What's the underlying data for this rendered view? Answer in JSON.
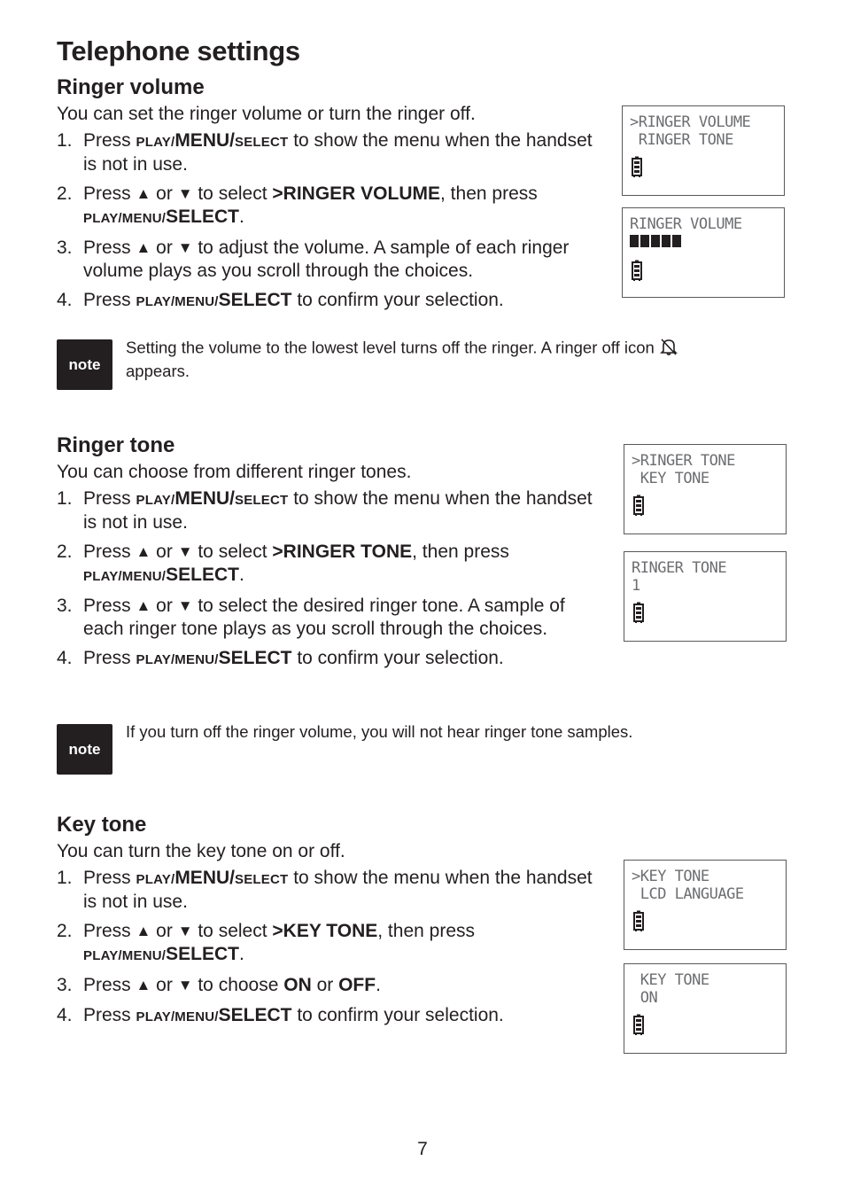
{
  "page": {
    "title": "Telephone settings",
    "page_number": "7"
  },
  "sections": [
    {
      "heading": "Ringer volume",
      "intro": "You can set the ringer volume or turn the ringer off.",
      "steps": [
        {
          "num": "1.",
          "segments": [
            {
              "t": "Press "
            },
            {
              "t": "PLAY/",
              "s": "sc"
            },
            {
              "t": "MENU/",
              "s": "lc"
            },
            {
              "t": "SELECT",
              "s": "sc"
            },
            {
              "t": " to show the menu when the handset is not in use."
            }
          ]
        },
        {
          "num": "2.",
          "segments": [
            {
              "t": "Press "
            },
            {
              "t": "▲",
              "s": "arrow"
            },
            {
              "t": " or "
            },
            {
              "t": "▼",
              "s": "arrow"
            },
            {
              "t": " to select "
            },
            {
              "t": ">RINGER VOLUME",
              "s": "b"
            },
            {
              "t": ", then press "
            },
            {
              "t": "PLAY/MENU/",
              "s": "sc"
            },
            {
              "t": "SELECT",
              "s": "lc"
            },
            {
              "t": "."
            }
          ]
        },
        {
          "num": "3.",
          "segments": [
            {
              "t": "Press "
            },
            {
              "t": "▲",
              "s": "arrow"
            },
            {
              "t": " or "
            },
            {
              "t": "▼",
              "s": "arrow"
            },
            {
              "t": " to adjust the volume. A sample of each ringer volume plays as you scroll through the choices."
            }
          ]
        },
        {
          "num": "4.",
          "segments": [
            {
              "t": "Press "
            },
            {
              "t": "PLAY/MENU/",
              "s": "sc"
            },
            {
              "t": "SELECT",
              "s": "lc"
            },
            {
              "t": " to confirm your selection."
            }
          ]
        }
      ],
      "screens": [
        {
          "lines": [
            ">RINGER VOLUME",
            " RINGER TONE"
          ],
          "battery": "battery-icon"
        },
        {
          "lines": [
            "RINGER VOLUME"
          ],
          "volume_level": 5,
          "volume_max": 5,
          "battery": "battery-icon"
        }
      ],
      "note": {
        "label": "note",
        "text_before_icon": "Setting the volume to the lowest level turns off the ringer. A ringer off icon",
        "icon": "ringer-off-icon",
        "text_after_icon": "appears."
      }
    },
    {
      "heading": "Ringer tone",
      "intro": "You can choose from different ringer tones.",
      "steps": [
        {
          "num": "1.",
          "segments": [
            {
              "t": "Press "
            },
            {
              "t": "PLAY/",
              "s": "sc"
            },
            {
              "t": "MENU/",
              "s": "lc"
            },
            {
              "t": "SELECT",
              "s": "sc"
            },
            {
              "t": " to show the menu when the handset is not in use."
            }
          ]
        },
        {
          "num": "2.",
          "segments": [
            {
              "t": "Press "
            },
            {
              "t": "▲",
              "s": "arrow"
            },
            {
              "t": " or "
            },
            {
              "t": "▼",
              "s": "arrow"
            },
            {
              "t": " to select "
            },
            {
              "t": ">RINGER TONE",
              "s": "b"
            },
            {
              "t": ", then press "
            },
            {
              "t": "PLAY/MENU/",
              "s": "sc"
            },
            {
              "t": "SELECT",
              "s": "lc"
            },
            {
              "t": "."
            }
          ]
        },
        {
          "num": "3.",
          "segments": [
            {
              "t": "Press "
            },
            {
              "t": "▲",
              "s": "arrow"
            },
            {
              "t": " or "
            },
            {
              "t": "▼",
              "s": "arrow"
            },
            {
              "t": " to select the desired ringer tone. A sample of each ringer tone plays as you scroll through the choices."
            }
          ]
        },
        {
          "num": "4.",
          "segments": [
            {
              "t": "Press "
            },
            {
              "t": "PLAY/MENU/",
              "s": "sc"
            },
            {
              "t": "SELECT",
              "s": "lc"
            },
            {
              "t": " to confirm your selection."
            }
          ]
        }
      ],
      "screens": [
        {
          "lines": [
            ">RINGER TONE",
            " KEY TONE"
          ],
          "battery": "battery-icon"
        },
        {
          "lines": [
            "RINGER TONE",
            "1"
          ],
          "battery": "battery-icon"
        }
      ],
      "note": {
        "label": "note",
        "text_before_icon": "If you turn off the ringer volume, you will not hear ringer tone samples."
      }
    },
    {
      "heading": "Key tone",
      "intro": "You can turn the key tone on or off.",
      "steps": [
        {
          "num": "1.",
          "segments": [
            {
              "t": "Press "
            },
            {
              "t": "PLAY/",
              "s": "sc"
            },
            {
              "t": "MENU/",
              "s": "lc"
            },
            {
              "t": "SELECT",
              "s": "sc"
            },
            {
              "t": " to show the menu when the handset is not in use."
            }
          ]
        },
        {
          "num": "2.",
          "segments": [
            {
              "t": "Press "
            },
            {
              "t": "▲",
              "s": "arrow"
            },
            {
              "t": " or "
            },
            {
              "t": "▼",
              "s": "arrow"
            },
            {
              "t": " to select "
            },
            {
              "t": ">KEY TONE",
              "s": "b"
            },
            {
              "t": ", then press "
            },
            {
              "t": "PLAY/MENU/",
              "s": "sc"
            },
            {
              "t": "SELECT",
              "s": "lc"
            },
            {
              "t": "."
            }
          ]
        },
        {
          "num": "3.",
          "segments": [
            {
              "t": "Press "
            },
            {
              "t": "▲",
              "s": "arrow"
            },
            {
              "t": " or "
            },
            {
              "t": "▼",
              "s": "arrow"
            },
            {
              "t": " to choose "
            },
            {
              "t": "ON",
              "s": "b"
            },
            {
              "t": " or "
            },
            {
              "t": "OFF",
              "s": "b"
            },
            {
              "t": "."
            }
          ]
        },
        {
          "num": "4.",
          "segments": [
            {
              "t": "Press "
            },
            {
              "t": "PLAY/MENU/",
              "s": "sc"
            },
            {
              "t": "SELECT",
              "s": "lc"
            },
            {
              "t": " to confirm your selection."
            }
          ]
        }
      ],
      "screens": [
        {
          "lines": [
            ">KEY TONE",
            " LCD LANGUAGE"
          ],
          "battery": "battery-icon"
        },
        {
          "lines": [
            " KEY TONE",
            " ON"
          ],
          "battery": "battery-icon"
        }
      ]
    }
  ]
}
